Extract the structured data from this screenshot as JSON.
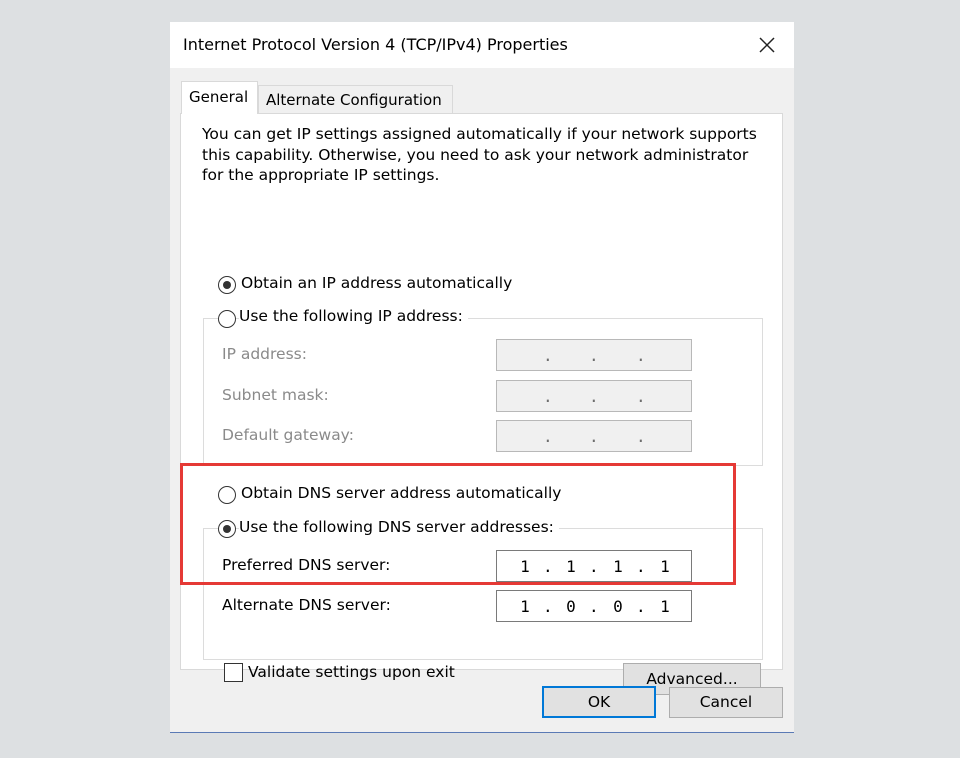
{
  "window": {
    "title": "Internet Protocol Version 4 (TCP/IPv4) Properties"
  },
  "tabs": [
    {
      "label": "General"
    },
    {
      "label": "Alternate Configuration"
    }
  ],
  "general": {
    "description": "You can get IP settings assigned automatically if your network supports this capability. Otherwise, you need to ask your network administrator for the appropriate IP settings.",
    "ip_mode": {
      "auto_label": "Obtain an IP address automatically",
      "manual_label": "Use the following IP address:",
      "selected": "auto"
    },
    "ip_fields": [
      {
        "label": "IP address:",
        "octets": [
          "",
          "",
          "",
          ""
        ]
      },
      {
        "label": "Subnet mask:",
        "octets": [
          "",
          "",
          "",
          ""
        ]
      },
      {
        "label": "Default gateway:",
        "octets": [
          "",
          "",
          "",
          ""
        ]
      }
    ],
    "dns_mode": {
      "auto_label": "Obtain DNS server address automatically",
      "manual_label": "Use the following DNS server addresses:",
      "selected": "manual"
    },
    "dns_fields": [
      {
        "label": "Preferred DNS server:",
        "octets": [
          "1",
          "1",
          "1",
          "1"
        ]
      },
      {
        "label": "Alternate DNS server:",
        "octets": [
          "1",
          "0",
          "0",
          "1"
        ]
      }
    ],
    "validate_label": "Validate settings upon exit",
    "validate_checked": false,
    "advanced_label": "Advanced..."
  },
  "buttons": {
    "ok": "OK",
    "cancel": "Cancel"
  },
  "colors": {
    "highlight": "#e53935",
    "default_button_border": "#0078d7"
  }
}
